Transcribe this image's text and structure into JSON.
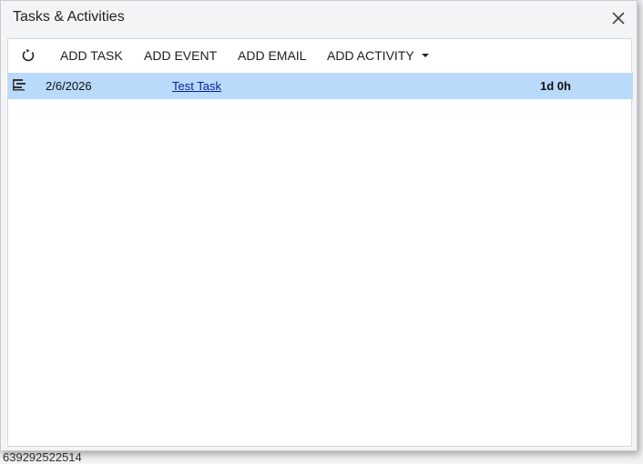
{
  "background": {
    "partial_number": "639292522514"
  },
  "dialog": {
    "title": "Tasks & Activities",
    "close_icon": "close-icon"
  },
  "toolbar": {
    "refresh_icon": "refresh-icon",
    "add_task": "ADD TASK",
    "add_event": "ADD EVENT",
    "add_email": "ADD EMAIL",
    "add_activity": "ADD ACTIVITY"
  },
  "rows": [
    {
      "type_icon": "task-icon",
      "date": "2/6/2026",
      "subject": "Test Task",
      "duration": "1d 0h",
      "selected": true
    }
  ],
  "colors": {
    "selected_row": "#b9dafb",
    "link": "#0b1e9e"
  }
}
